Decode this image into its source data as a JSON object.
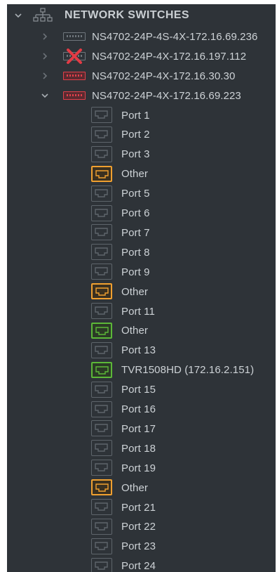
{
  "tree": {
    "root": {
      "label": "NETWORK SWITCHES"
    },
    "switches": [
      {
        "label": "NS4702-24P-4S-4X-172.16.69.236",
        "status": "normal",
        "expanded": false
      },
      {
        "label": "NS4702-24P-4X-172.16.197.112",
        "status": "offline",
        "expanded": false
      },
      {
        "label": "NS4702-24P-4X-172.16.30.30",
        "status": "alarm",
        "expanded": false
      },
      {
        "label": "NS4702-24P-4X-172.16.69.223",
        "status": "alarm",
        "expanded": true
      }
    ],
    "ports": [
      {
        "label": "Port 1",
        "state": "empty"
      },
      {
        "label": "Port 2",
        "state": "empty"
      },
      {
        "label": "Port 3",
        "state": "empty"
      },
      {
        "label": "Other",
        "state": "orange"
      },
      {
        "label": "Port 5",
        "state": "empty"
      },
      {
        "label": "Port 6",
        "state": "empty"
      },
      {
        "label": "Port 7",
        "state": "empty"
      },
      {
        "label": "Port 8",
        "state": "empty"
      },
      {
        "label": "Port 9",
        "state": "empty"
      },
      {
        "label": "Other",
        "state": "orange"
      },
      {
        "label": "Port 11",
        "state": "empty"
      },
      {
        "label": "Other",
        "state": "green"
      },
      {
        "label": "Port 13",
        "state": "empty"
      },
      {
        "label": "TVR1508HD (172.16.2.151)",
        "state": "green"
      },
      {
        "label": "Port 15",
        "state": "empty"
      },
      {
        "label": "Port 16",
        "state": "empty"
      },
      {
        "label": "Port 17",
        "state": "empty"
      },
      {
        "label": "Port 18",
        "state": "empty"
      },
      {
        "label": "Port 19",
        "state": "empty"
      },
      {
        "label": "Other",
        "state": "orange"
      },
      {
        "label": "Port 21",
        "state": "empty"
      },
      {
        "label": "Port 22",
        "state": "empty"
      },
      {
        "label": "Port 23",
        "state": "empty"
      },
      {
        "label": "Port 24",
        "state": "empty"
      }
    ]
  },
  "colors": {
    "background": "#2e3338",
    "text": "#cdd2d6",
    "port_empty": "#5e656b",
    "port_orange": "#f0a030",
    "port_green": "#5cb838",
    "switch_alarm": "#e0404a"
  }
}
